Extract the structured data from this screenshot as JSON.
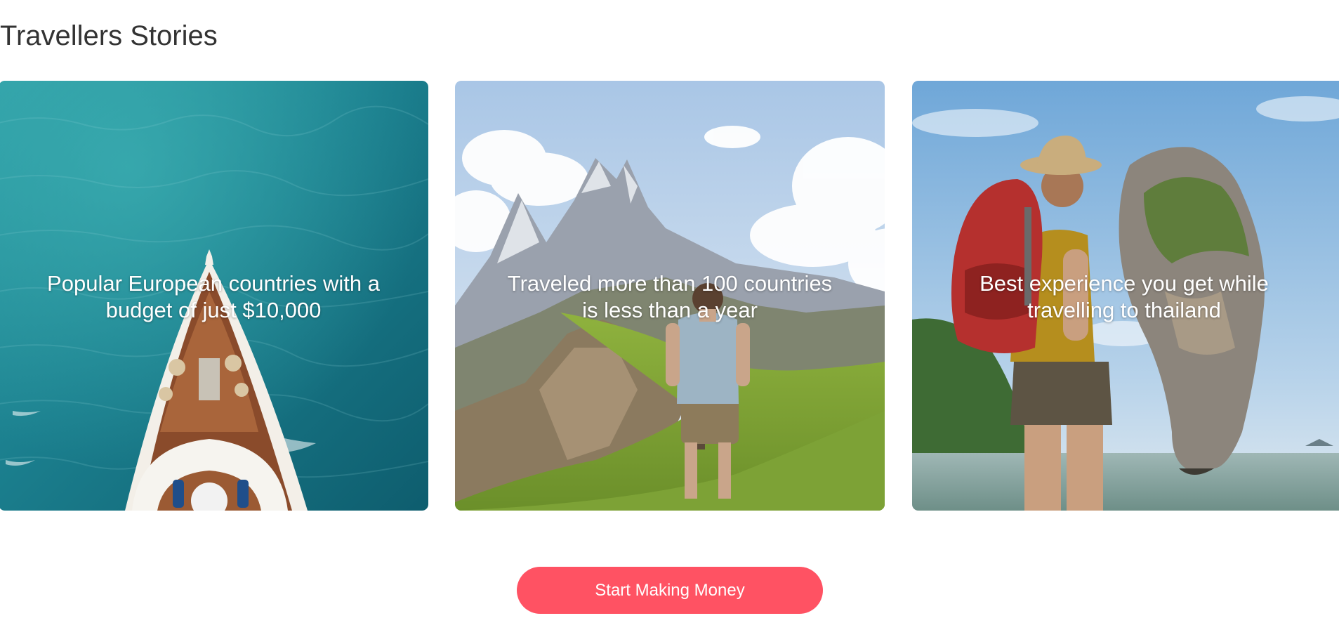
{
  "section": {
    "title": "Travellers Stories"
  },
  "cards": [
    {
      "caption": "Popular European countries with a budget of just $10,000",
      "image": "boat-on-sea-aerial-photo"
    },
    {
      "caption": "Traveled more than 100 countries is less than a year",
      "image": "hiker-facing-mountains-photo"
    },
    {
      "caption": "Best experience you get while travelling to thailand",
      "image": "backpacker-by-limestone-rock-photo"
    }
  ],
  "cta": {
    "label": "Start Making Money",
    "color": "#ff5263"
  }
}
